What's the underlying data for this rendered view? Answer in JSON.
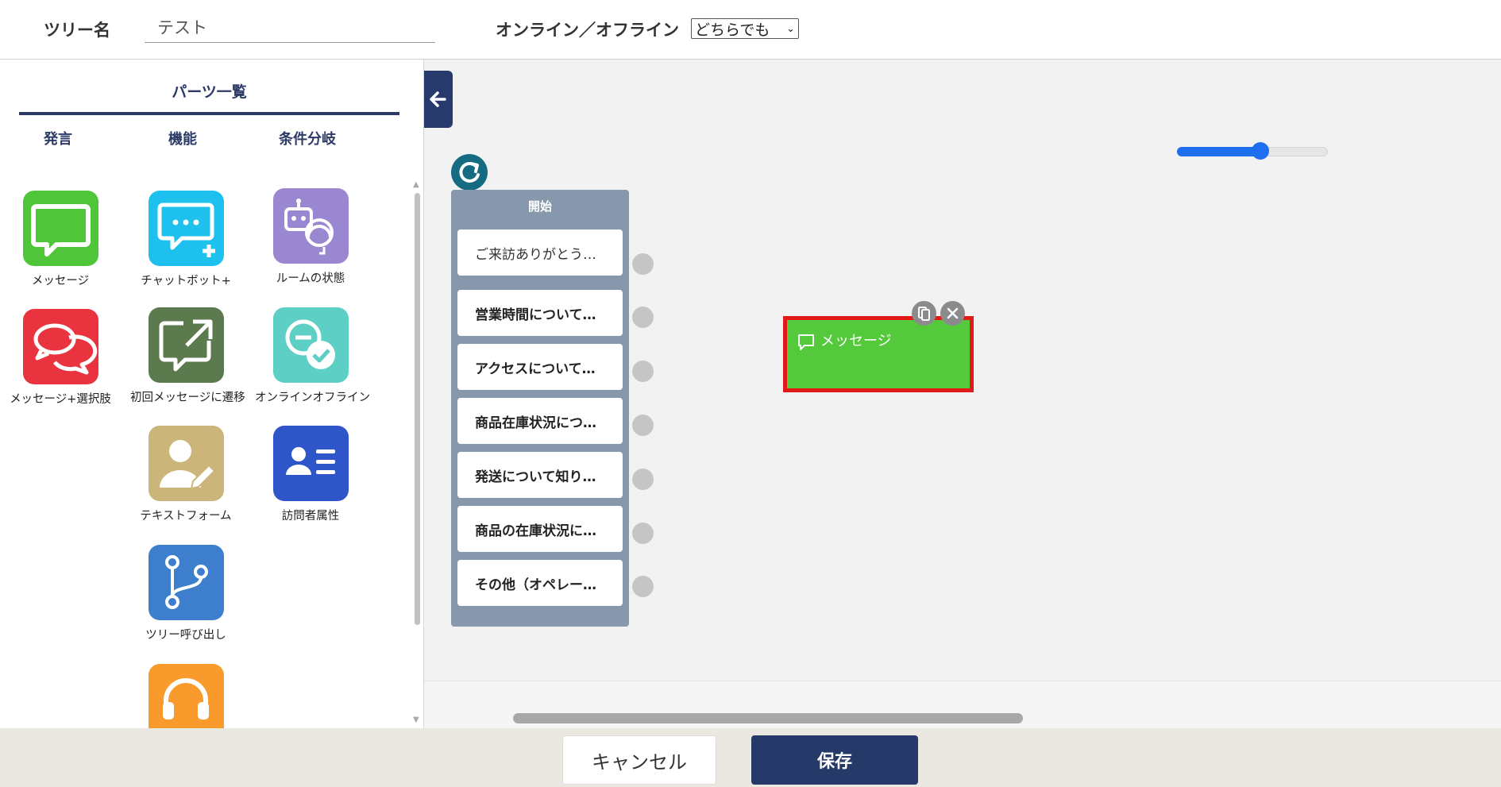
{
  "header": {
    "tree_name_label": "ツリー名",
    "tree_name_value": "テスト",
    "online_label": "オンライン／オフライン",
    "online_select_value": "どちらでも"
  },
  "parts_panel": {
    "title": "パーツ一覧",
    "tabs": [
      "発言",
      "機能",
      "条件分岐"
    ],
    "items": [
      {
        "label": "メッセージ",
        "icon": "message-bubble-icon",
        "color": "#4fc63a"
      },
      {
        "label": "チャットボット+",
        "icon": "chatbot-plus-icon",
        "color": "#1ec1ee"
      },
      {
        "label": "ルームの状態",
        "icon": "robot-operator-icon",
        "color": "#9a87d2"
      },
      {
        "label": "メッセージ+選択肢",
        "icon": "double-bubble-icon",
        "color": "#e9343f"
      },
      {
        "label": "初回メッセージに遷移",
        "icon": "external-link-bubble-icon",
        "color": "#5b7a4e"
      },
      {
        "label": "オンラインオフライン",
        "icon": "online-check-icon",
        "color": "#5dcfc4"
      },
      {
        "label": "テキストフォーム",
        "icon": "user-edit-icon",
        "color": "#ccb57a"
      },
      {
        "label": "訪問者属性",
        "icon": "id-card-icon",
        "color": "#2f56c9"
      },
      {
        "label": "ツリー呼び出し",
        "icon": "branch-icon",
        "color": "#3d7fcc"
      },
      {
        "label": "",
        "icon": "headset-icon",
        "color": "#f99a2d"
      }
    ]
  },
  "canvas": {
    "zoom_level": 0.55,
    "start_node": {
      "title": "開始",
      "options": [
        "ご来訪ありがとう…",
        "営業時間について…",
        "アクセスについて…",
        "商品在庫状況につ…",
        "発送について知り…",
        "商品の在庫状況に…",
        "その他（オペレー…"
      ]
    },
    "message_node": {
      "label": "メッセージ",
      "color": "#55c93c",
      "selected_border_color": "#e01919"
    }
  },
  "footer": {
    "cancel_label": "キャンセル",
    "save_label": "保存"
  },
  "colors": {
    "navy": "#253a68",
    "canvas_bg": "#f2f2f2",
    "zoom_accent": "#1e6ef0"
  }
}
